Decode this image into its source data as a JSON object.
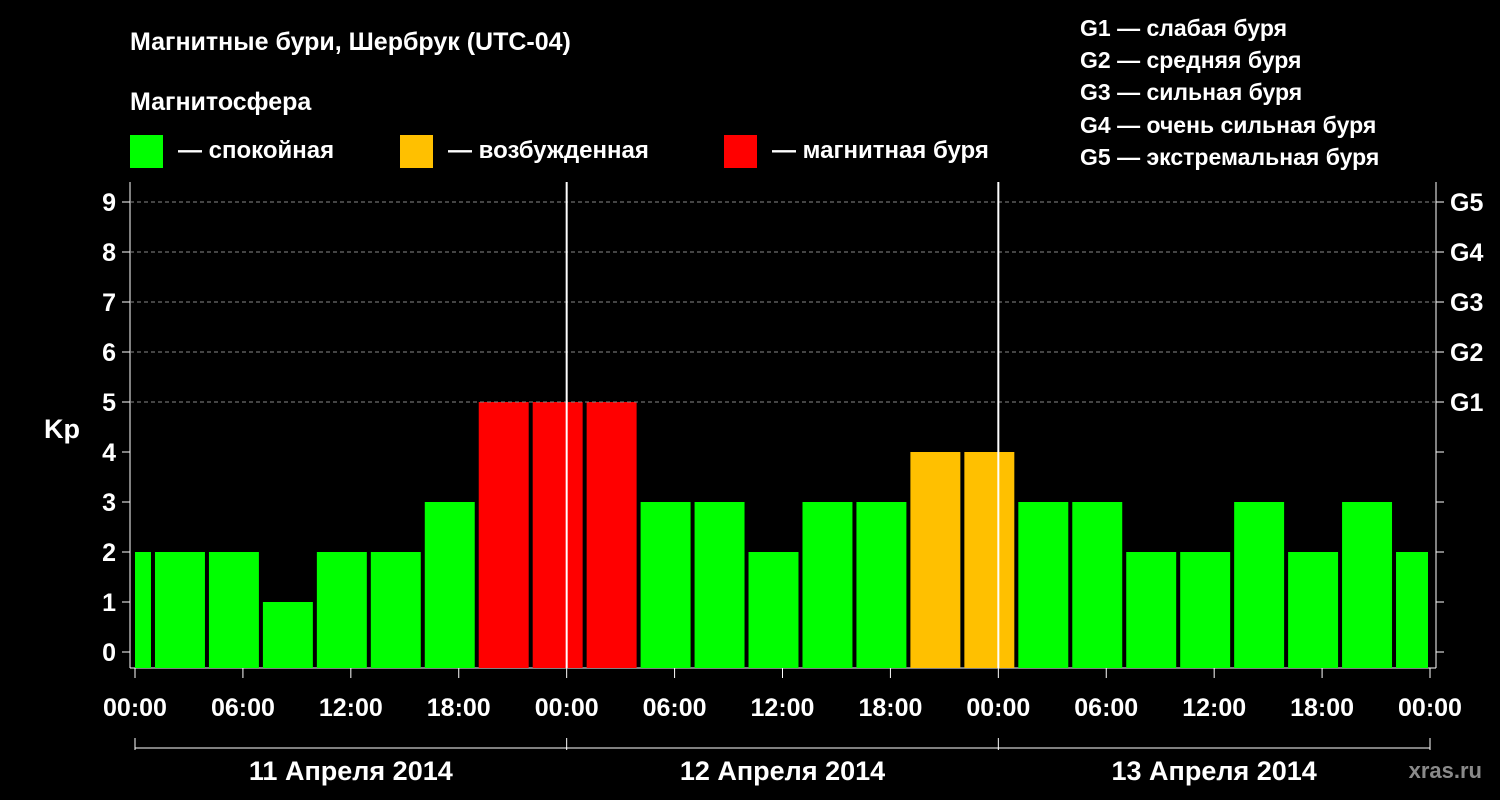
{
  "title": "Магнитные бури, Шербрук (UTC-04)",
  "legend": {
    "heading": "Магнитосфера",
    "items": [
      {
        "color": "#00ff00",
        "label": "— спокойная"
      },
      {
        "color": "#ffc000",
        "label": "— возбужденная"
      },
      {
        "color": "#ff0000",
        "label": "— магнитная буря"
      }
    ]
  },
  "g_scale": [
    "G1 — слабая буря",
    "G2 — средняя буря",
    "G3 — сильная буря",
    "G4 — очень сильная буря",
    "G5 — экстремальная буря"
  ],
  "watermark": "xras.ru",
  "chart_data": {
    "type": "bar",
    "ylabel": "Kp",
    "ylim": [
      0,
      9
    ],
    "yticks": [
      0,
      1,
      2,
      3,
      4,
      5,
      6,
      7,
      8,
      9
    ],
    "right_labels": [
      {
        "y": 5,
        "label": "G1"
      },
      {
        "y": 6,
        "label": "G2"
      },
      {
        "y": 7,
        "label": "G3"
      },
      {
        "y": 8,
        "label": "G4"
      },
      {
        "y": 9,
        "label": "G5"
      }
    ],
    "x_ticks": [
      "00:00",
      "06:00",
      "12:00",
      "18:00",
      "00:00",
      "06:00",
      "12:00",
      "18:00",
      "00:00",
      "06:00",
      "12:00",
      "18:00",
      "00:00"
    ],
    "days": [
      "11 Апреля 2014",
      "12 Апреля 2014",
      "13 Апреля 2014"
    ],
    "interval_hours": 3,
    "start_offset_hours": -2,
    "values": [
      2,
      2,
      2,
      1,
      2,
      2,
      3,
      5,
      5,
      5,
      3,
      3,
      2,
      3,
      3,
      4,
      4,
      3,
      3,
      2,
      2,
      3,
      2,
      3,
      2
    ],
    "level_colors": {
      "quiet": "#00ff00",
      "active": "#ffc000",
      "storm": "#ff0000"
    },
    "grid": true
  }
}
